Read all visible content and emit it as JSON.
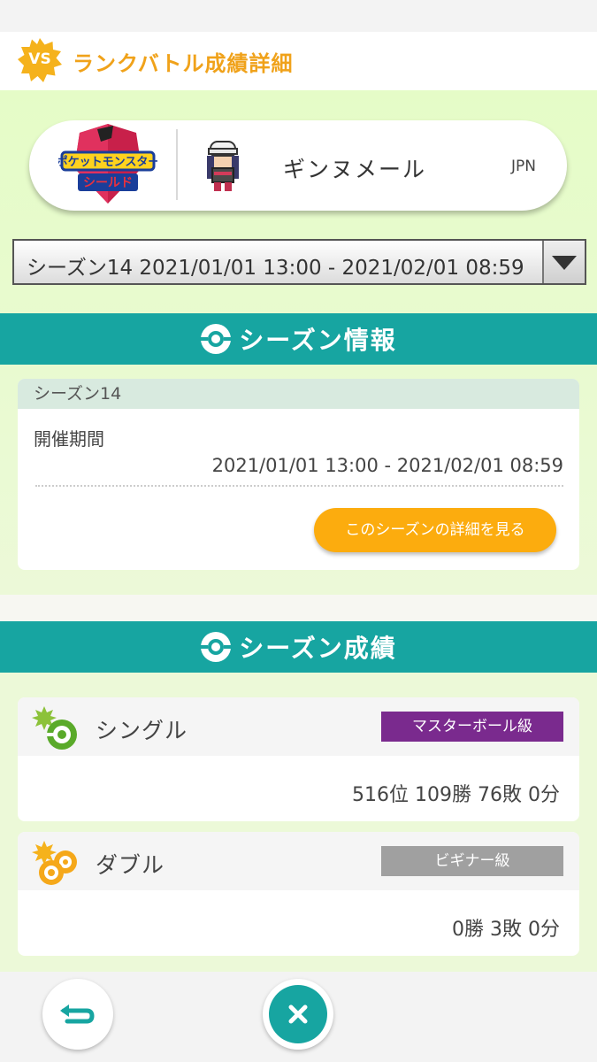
{
  "header": {
    "badge": "VS",
    "title": "ランクバトル成績詳細"
  },
  "profile": {
    "game_logo_line1": "ポケットモンスター",
    "game_logo_line2": "シールド",
    "trainer_name": "ギンヌメール",
    "region": "JPN"
  },
  "season_select": {
    "selected": "シーズン14 2021/01/01 13:00 - 2021/02/01 08:59"
  },
  "season_info": {
    "section_title": "シーズン情報",
    "card_title": "シーズン14",
    "period_label": "開催期間",
    "period_value": "2021/01/01 13:00 - 2021/02/01 08:59",
    "detail_button": "このシーズンの詳細を見る"
  },
  "season_results": {
    "section_title": "シーズン成績",
    "single": {
      "label": "シングル",
      "rank_badge": "マスターボール級",
      "badge_color": "#7a2a8e",
      "record": "516位 109勝 76敗 0分"
    },
    "double": {
      "label": "ダブル",
      "rank_badge": "ビギナー級",
      "badge_color": "#a0a0a0",
      "record": "0勝 3敗 0分"
    }
  },
  "colors": {
    "accent_orange": "#f0a21a",
    "teal": "#17a5a1",
    "button_orange": "#fcac0e"
  },
  "footer": {
    "back_icon": "back-arrow-icon",
    "close_icon": "close-icon"
  }
}
